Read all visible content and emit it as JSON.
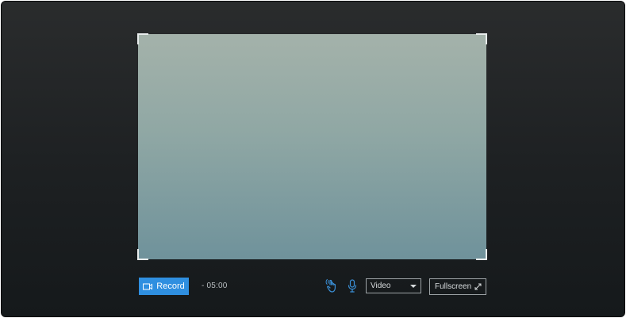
{
  "controls": {
    "record_label": "Record",
    "timer": "- 05:00",
    "source_select": {
      "selected": "Video"
    },
    "fullscreen_label": "Fullscreen"
  },
  "icons": {
    "record": "video-camera-icon",
    "gesture": "hand-gesture-icon",
    "microphone": "microphone-icon",
    "dropdown": "caret-down-icon",
    "fullscreen": "expand-arrows-icon"
  },
  "colors": {
    "accent": "#2f8fe0",
    "background": "#1d2022",
    "capture_top": "#a4b2aa",
    "capture_bottom": "#6f929b"
  }
}
